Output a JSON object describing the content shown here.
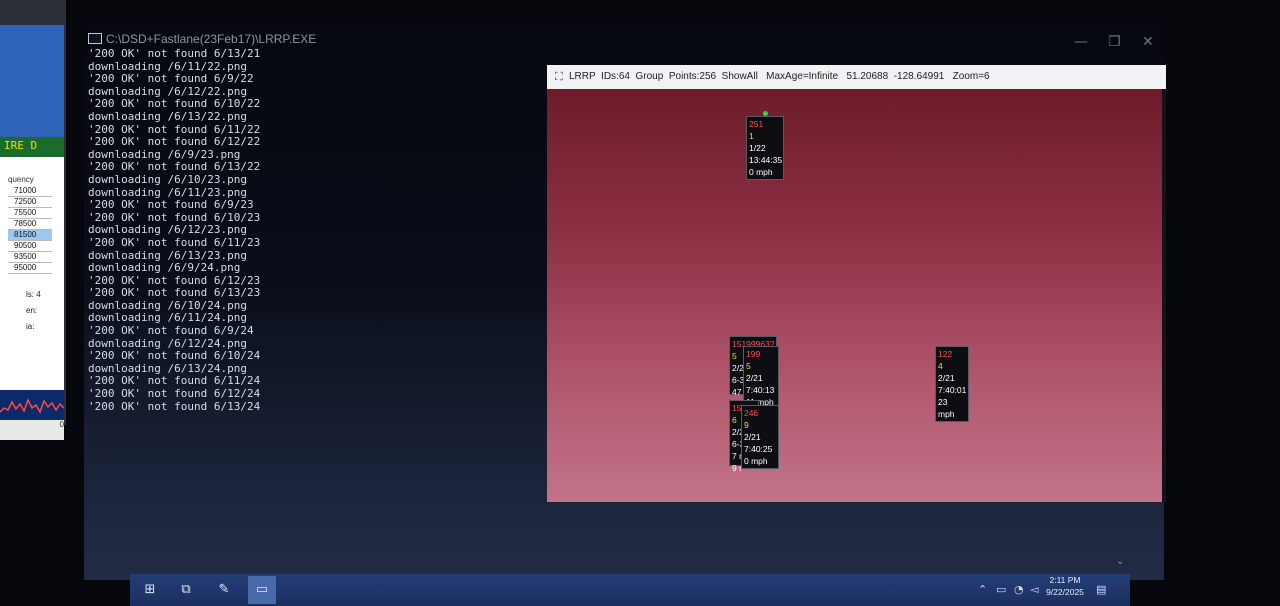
{
  "left_app": {
    "banner": "IRE D",
    "list_header": "quency",
    "list_items": [
      "71000",
      "72500",
      "75500",
      "78500",
      "81500",
      "90500",
      "93500",
      "95000"
    ],
    "selected_index": 4,
    "mini_labels": [
      "ls: 4",
      "en:",
      "ia:"
    ],
    "bottom_value": "0"
  },
  "console": {
    "title": "C:\\DSD+Fastlane(23Feb17)\\LRRP.EXE",
    "lines": [
      "'200 OK' not found 6/13/21",
      "downloading /6/11/22.png",
      "'200 OK' not found 6/9/22",
      "downloading /6/12/22.png",
      "'200 OK' not found 6/10/22",
      "downloading /6/13/22.png",
      "'200 OK' not found 6/11/22",
      "'200 OK' not found 6/12/22",
      "downloading /6/9/23.png",
      "'200 OK' not found 6/13/22",
      "downloading /6/10/23.png",
      "downloading /6/11/23.png",
      "'200 OK' not found 6/9/23",
      "'200 OK' not found 6/10/23",
      "downloading /6/12/23.png",
      "'200 OK' not found 6/11/23",
      "downloading /6/13/23.png",
      "downloading /6/9/24.png",
      "'200 OK' not found 6/12/23",
      "'200 OK' not found 6/13/23",
      "downloading /6/10/24.png",
      "downloading /6/11/24.png",
      "'200 OK' not found 6/9/24",
      "downloading /6/12/24.png",
      "'200 OK' not found 6/10/24",
      "downloading /6/13/24.png",
      "'200 OK' not found 6/11/24",
      "'200 OK' not found 6/12/24",
      "'200 OK' not found 6/13/24"
    ],
    "controls": {
      "minimize": "—",
      "maximize": "❐",
      "close": "✕"
    }
  },
  "lrrp": {
    "title": "LRRP  IDs:64  Group  Points:256  ShowAll   MaxAge=Infinite   51.20688  -128.64991   Zoom=6",
    "markers": [
      {
        "id": "251",
        "group": "1",
        "date": "1/22",
        "time": "13:44:35",
        "speed": "0 mph"
      },
      {
        "id": "15199963?",
        "group": "5",
        "date": "2/2",
        "time": "6-3",
        "speed": "47"
      },
      {
        "id": "199",
        "group": "5",
        "date": "2/21",
        "time": "7:40:13",
        "speed": "11 mph"
      },
      {
        "id": "151",
        "group": "6",
        "date": "2/2",
        "time": "6-3",
        "speed": "7 m"
      },
      {
        "id": "246",
        "group": "9",
        "date": "2/21",
        "time": "7:40:25",
        "speed": "0 mph"
      },
      {
        "id": "122",
        "group": "4",
        "date": "2/21",
        "time": "7:40:01",
        "speed": "23 mph"
      }
    ],
    "marker_extra": "9 r"
  },
  "taskbar": {
    "start_icon": "windows-start-icon",
    "time": "2:11 PM",
    "date": "9/22/2025",
    "scroll_arrow": "⌄"
  }
}
